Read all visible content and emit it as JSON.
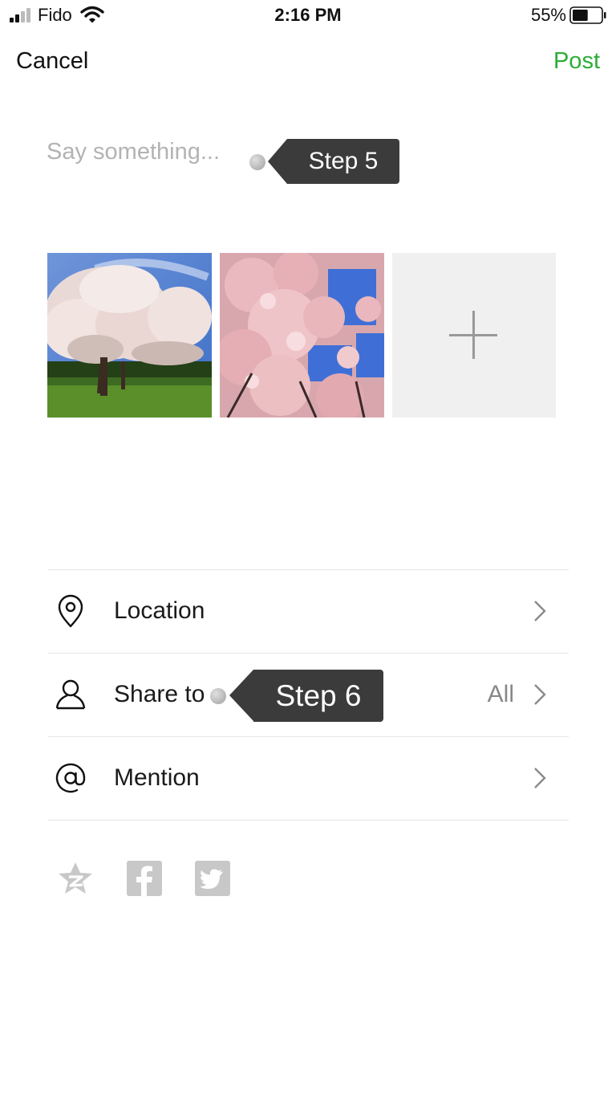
{
  "status_bar": {
    "carrier": "Fido",
    "time": "2:16 PM",
    "battery_percent": "55%",
    "battery_level": 0.55,
    "signal_bars": 2
  },
  "nav": {
    "cancel_label": "Cancel",
    "post_label": "Post",
    "post_color": "#2aae35"
  },
  "composer": {
    "placeholder": "Say something...",
    "value": ""
  },
  "tooltips": [
    {
      "label": "Step 5"
    },
    {
      "label": "Step 6"
    }
  ],
  "photos": [
    {
      "icon": "cherry-blossom-tree-photo"
    },
    {
      "icon": "cherry-blossom-closeup-photo"
    }
  ],
  "add_tile": {
    "icon": "plus-icon"
  },
  "options": [
    {
      "label": "Location",
      "value": "",
      "icon": "location-pin-icon"
    },
    {
      "label": "Share to",
      "value": "All",
      "icon": "person-icon"
    },
    {
      "label": "Mention",
      "value": "",
      "icon": "at-sign-icon"
    }
  ],
  "share_targets": [
    {
      "icon": "qzone-icon"
    },
    {
      "icon": "facebook-icon"
    },
    {
      "icon": "twitter-icon"
    }
  ]
}
